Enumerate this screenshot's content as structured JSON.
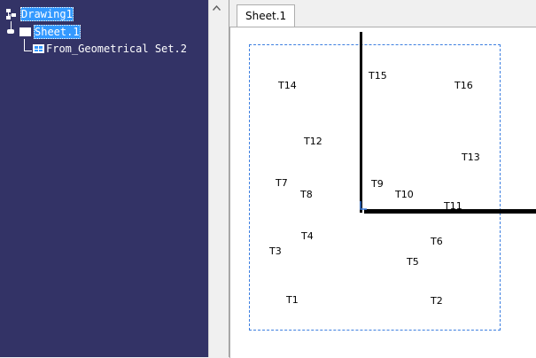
{
  "tree": {
    "root": "Drawing1",
    "sheet": "Sheet.1",
    "view": "From_Geometrical Set.2"
  },
  "tabs": [
    {
      "label": "Sheet.1",
      "active": true
    }
  ],
  "points": [
    "T1",
    "T2",
    "T3",
    "T4",
    "T5",
    "T6",
    "T7",
    "T8",
    "T9",
    "T10",
    "T11",
    "T12",
    "T13",
    "T14",
    "T15",
    "T16"
  ],
  "colors": {
    "tree_bg": "#333366",
    "selection": "#3399ff",
    "frame": "#3d7fe0",
    "axis": "#000000"
  },
  "icons": [
    "tree-root-icon",
    "sheet-icon",
    "view-icon",
    "scroll-up-arrow-icon",
    "origin-icon"
  ]
}
